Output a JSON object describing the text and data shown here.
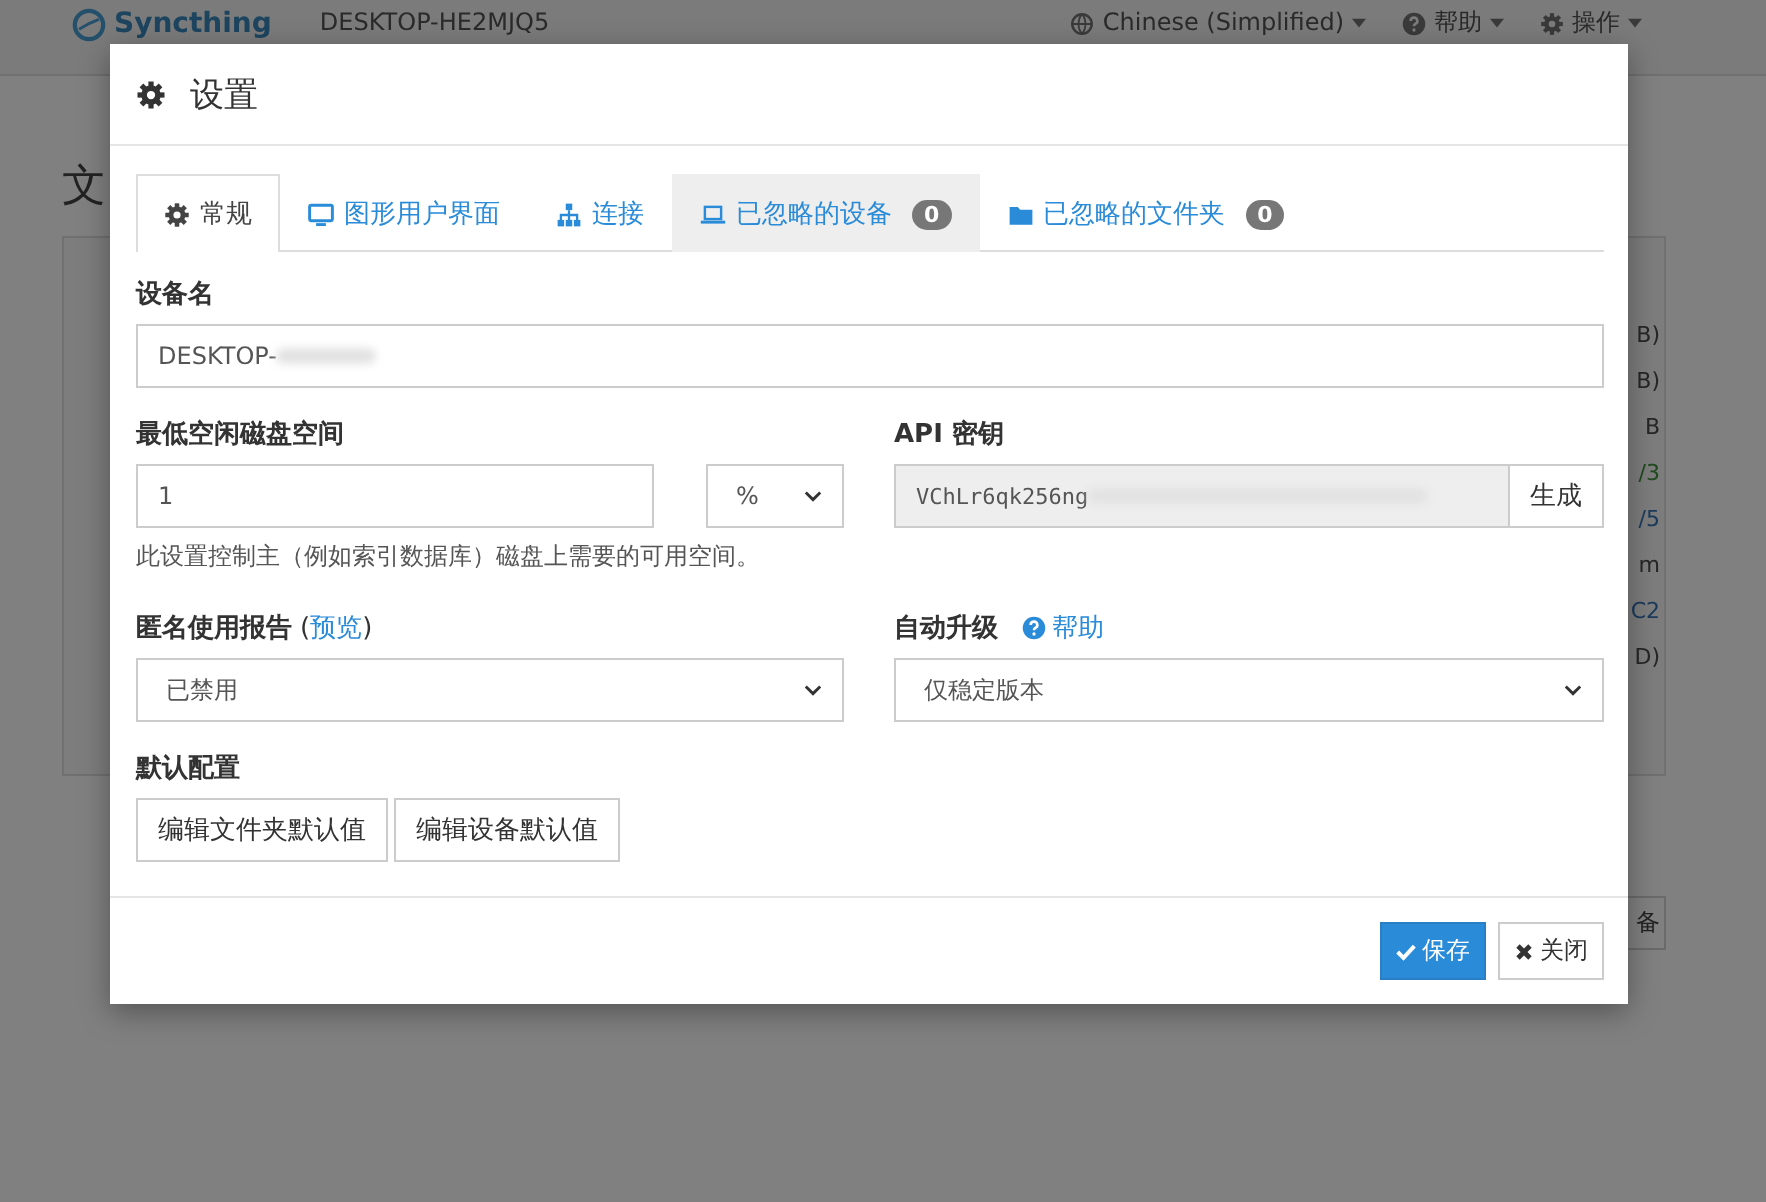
{
  "background": {
    "brand": "Syncthing",
    "device": "DESKTOP-HE2MJQ5",
    "menu": [
      {
        "kind": "language",
        "label": "Chinese (Simplified)"
      },
      {
        "kind": "help",
        "label": "帮助"
      },
      {
        "kind": "actions",
        "label": "操作"
      }
    ],
    "heading": "文",
    "fragments": [
      {
        "text": "B)",
        "color": "#262626"
      },
      {
        "text": "B)",
        "color": "#262626"
      },
      {
        "text": "B",
        "color": "#262626"
      },
      {
        "text": "/3",
        "color": "#1f4a1f"
      },
      {
        "text": "/5",
        "color": "#1a3a5c"
      },
      {
        "text": "m",
        "color": "#262626"
      },
      {
        "text": "C2",
        "color": "#1a3a5c"
      },
      {
        "text": "D)",
        "color": "#262626"
      }
    ],
    "button": "备"
  },
  "dialog": {
    "title": "设置",
    "tabs": [
      {
        "kind": "gear",
        "label": "常规",
        "selected": true,
        "highlighted": false
      },
      {
        "kind": "monitor",
        "label": "图形用户界面",
        "selected": false,
        "highlighted": false
      },
      {
        "kind": "sitemap",
        "label": "连接",
        "selected": false,
        "highlighted": false
      },
      {
        "kind": "laptop",
        "label": "已忽略的设备",
        "badge": "0",
        "selected": false,
        "highlighted": true
      },
      {
        "kind": "folder",
        "label": "已忽略的文件夹",
        "badge": "0",
        "selected": false,
        "highlighted": false
      }
    ],
    "device_name": {
      "label": "设备名",
      "value": "DESKTOP-"
    },
    "min_disk": {
      "label": "最低空闲磁盘空间",
      "value": "1",
      "unit": "%",
      "help": "此设置控制主（例如索引数据库）磁盘上需要的可用空间。"
    },
    "api_key": {
      "label": "API 密钥",
      "value": "VChLr6qk256ng",
      "button": "生成"
    },
    "usage_report": {
      "label": "匿名使用报告",
      "link_open": "(",
      "link": "预览",
      "link_close": ")",
      "value": "已禁用"
    },
    "auto_upgrade": {
      "label": "自动升级",
      "help_link": "帮助",
      "value": "仅稳定版本"
    },
    "defaults": {
      "label": "默认配置",
      "buttons": [
        "编辑文件夹默认值",
        "编辑设备默认值"
      ]
    },
    "footer": {
      "save": "保存",
      "close": "关闭"
    }
  }
}
